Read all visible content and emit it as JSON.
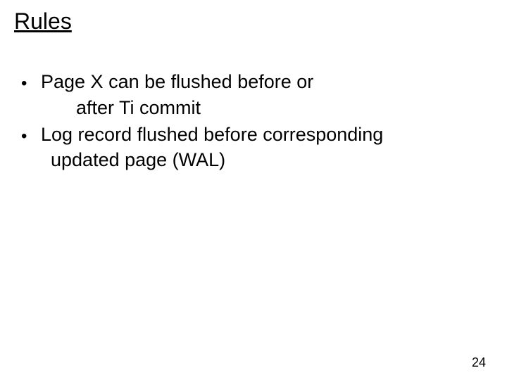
{
  "title": "Rules",
  "bullets": [
    {
      "line1": "Page X can be flushed before or",
      "line2": "after Ti commit"
    },
    {
      "line1": "Log record flushed before corresponding",
      "line2": "updated page (WAL)"
    }
  ],
  "page_number": "24"
}
